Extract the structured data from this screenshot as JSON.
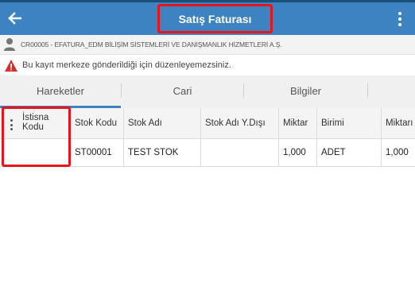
{
  "appbar": {
    "title": "Satış Faturası",
    "background_color": "#3d83c1",
    "back_icon": "arrow-left-icon",
    "menu_icon": "more-vertical-icon"
  },
  "company": {
    "icon": "person-icon",
    "text": "CR00005 - EFATURA_EDM BİLİŞİM SİSTEMLERİ VE DANIŞMANLIK HİZMETLERİ A.Ş."
  },
  "warning": {
    "icon": "warning-icon",
    "icon_color": "#d32f2f",
    "text": "Bu kayıt merkeze gönderildiği için düzenleyemezsiniz."
  },
  "tabs": [
    {
      "label": "Hareketler",
      "active": true
    },
    {
      "label": "Cari",
      "active": false
    },
    {
      "label": "Bilgiler",
      "active": false
    }
  ],
  "grid": {
    "options_icon": "more-vertical-icon",
    "columns": [
      "İstisna Kodu",
      "Stok Kodu",
      "Stok Adı",
      "Stok Adı Y.Dışı",
      "Miktar",
      "Birimi",
      "Miktarı"
    ],
    "rows": [
      [
        "",
        "ST00001",
        "TEST STOK",
        "",
        "1,000",
        "ADET",
        "1,000"
      ]
    ]
  },
  "annotation_color": "#e8141c"
}
